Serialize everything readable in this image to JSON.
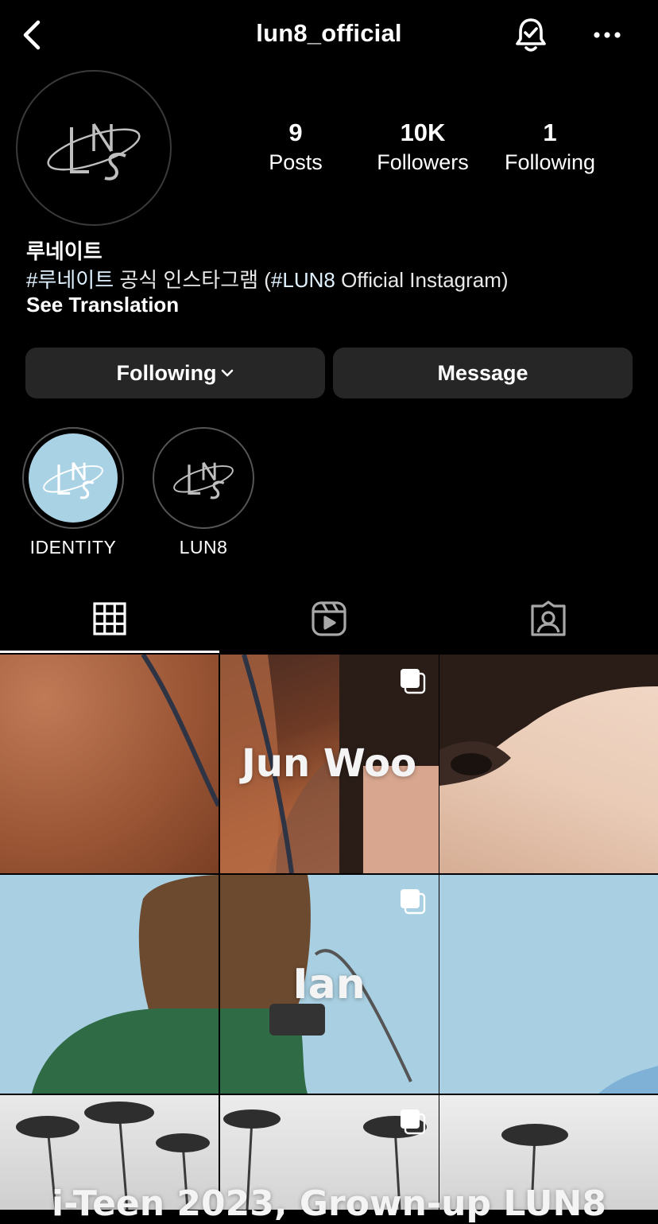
{
  "header": {
    "username": "lun8_official",
    "back_icon": "chevron-left-icon",
    "bell_icon": "bell-check-icon",
    "more_icon": "more-horizontal-icon"
  },
  "profile": {
    "avatar_logo": "LN8",
    "stats": [
      {
        "value": "9",
        "label": "Posts"
      },
      {
        "value": "10K",
        "label": "Followers"
      },
      {
        "value": "1",
        "label": "Following"
      }
    ],
    "name": "루네이트",
    "bio_tag_ko": "#루네이트",
    "bio_mid": " 공식 인스타그램 (",
    "bio_tag_en": "#LUN8",
    "bio_end": " Official Instagram)",
    "see_translation": "See Translation"
  },
  "actions": {
    "following_label": "Following",
    "message_label": "Message"
  },
  "highlights": [
    {
      "label": "IDENTITY",
      "bg": "#a9d2e4"
    },
    {
      "label": "LUN8",
      "bg": "#000000"
    }
  ],
  "tabs": [
    {
      "icon": "grid-icon",
      "active": true
    },
    {
      "icon": "reels-icon",
      "active": false
    },
    {
      "icon": "tagged-icon",
      "active": false
    }
  ],
  "grid": {
    "row1_text": "Jun Woo",
    "row2_text": "Ian",
    "row3_text": "i-Teen 2023, Grown-up LUN8"
  },
  "colors": {
    "background": "#000000",
    "button_bg": "#262626",
    "sky_blue": "#a9d2e4",
    "hashtag": "#e0f1ff"
  }
}
